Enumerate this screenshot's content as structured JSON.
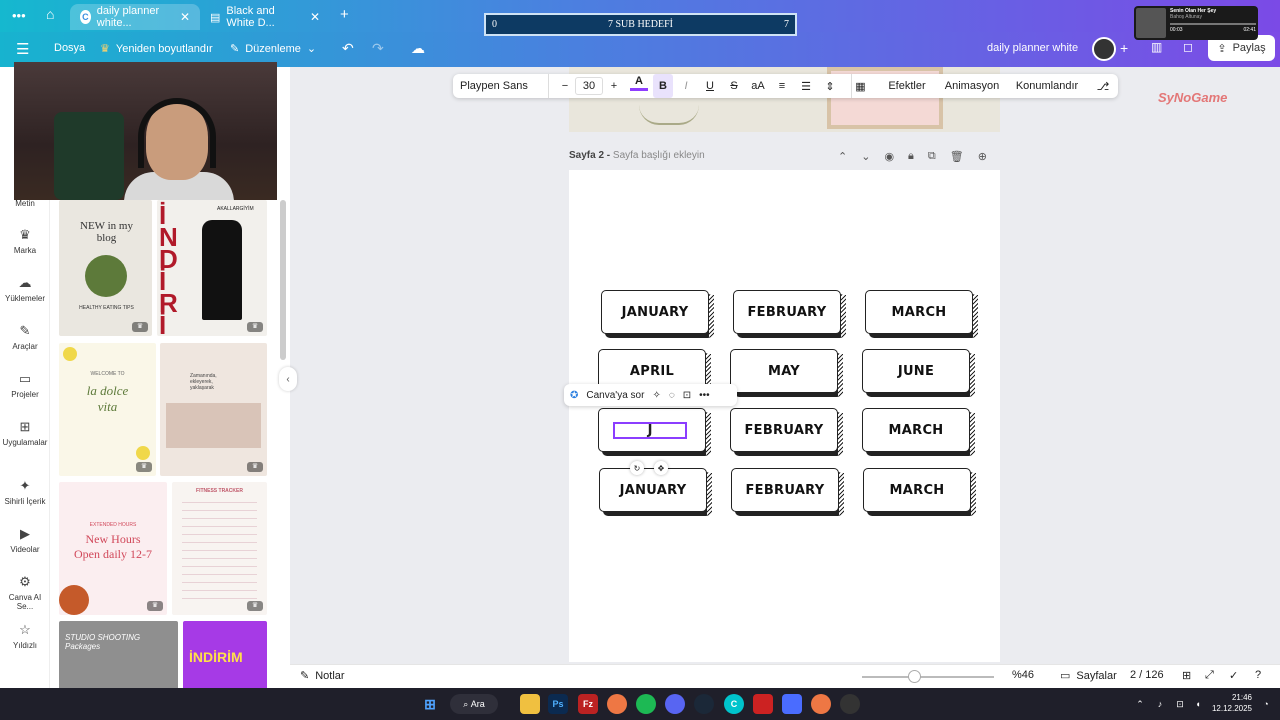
{
  "browser": {
    "tabs": [
      {
        "title": "daily planner white...",
        "active": true
      },
      {
        "title": "Black and White D...",
        "active": false
      }
    ]
  },
  "overlay": {
    "sub_goal": {
      "current": "0",
      "title": "7 SUB HEDEFİ",
      "target": "7"
    },
    "music": {
      "song": "Senin Olan Her Şey",
      "artist": "Bahoş Altunay",
      "elapsed": "00:03",
      "total": "02:41"
    }
  },
  "menu": {
    "file": "Dosya",
    "resize": "Yeniden boyutlandır",
    "editing": "Düzenleme",
    "design_title": "daily planner white",
    "share": "Paylaş"
  },
  "rail": [
    {
      "label": "Metin",
      "icon": "T"
    },
    {
      "label": "Marka",
      "icon": "♛"
    },
    {
      "label": "Yüklemeler",
      "icon": "☁"
    },
    {
      "label": "Araçlar",
      "icon": "✎"
    },
    {
      "label": "Projeler",
      "icon": "▭"
    },
    {
      "label": "Uygulamalar",
      "icon": "⊞"
    },
    {
      "label": "Sihirli İçerik",
      "icon": "✦"
    },
    {
      "label": "Videolar",
      "icon": "▶"
    },
    {
      "label": "Canva AI Se...",
      "icon": "⚙"
    },
    {
      "label": "Yıldızlı",
      "icon": "☆"
    }
  ],
  "templates": [
    {
      "title": "NEW in my blog",
      "subtitle": "HEALTHY EATING TIPS",
      "pro": true
    },
    {
      "title": "İNDİRİM",
      "subtitle": "AKALLARGİYİM",
      "pro": true
    },
    {
      "title": "la dolce vita",
      "subtitle": "WELCOME TO",
      "pro": true
    },
    {
      "title": "Zamanında, ekleyerek, yaklaşarak",
      "pro": true
    },
    {
      "title": "New Hours Open daily 12-7",
      "subtitle": "EXTENDED HOURS",
      "pro": true
    },
    {
      "title": "FITNESS TRACKER",
      "pro": true
    },
    {
      "title": "STUDIO SHOOTING Packages",
      "pro": false
    },
    {
      "title": "İNDİRİM",
      "pro": false
    }
  ],
  "text_toolbar": {
    "font": "Playpen Sans",
    "size": "30",
    "effects": "Efektler",
    "animation": "Animasyon",
    "position": "Konumlandır"
  },
  "page": {
    "label": "Sayfa 2 -",
    "title_placeholder": "Sayfa başlığı ekleyin"
  },
  "months": [
    [
      "JANUARY",
      "FEBRUARY",
      "MARCH"
    ],
    [
      "APRIL",
      "MAY",
      "JUNE"
    ],
    [
      "J",
      "FEBRUARY",
      "MARCH"
    ],
    [
      "JANUARY",
      "FEBRUARY",
      "MARCH"
    ]
  ],
  "editing_text": "J",
  "ask_bar": {
    "label": "Canva'ya sor"
  },
  "bottom": {
    "notes": "Notlar",
    "zoom": "%46",
    "zoom_level": 0.46,
    "pages": "Sayfalar",
    "page_count": "2 / 126"
  },
  "watermark": "SyNoGame",
  "taskbar": {
    "search": "Ara",
    "time": "21:46",
    "date": "12.12.2025"
  }
}
